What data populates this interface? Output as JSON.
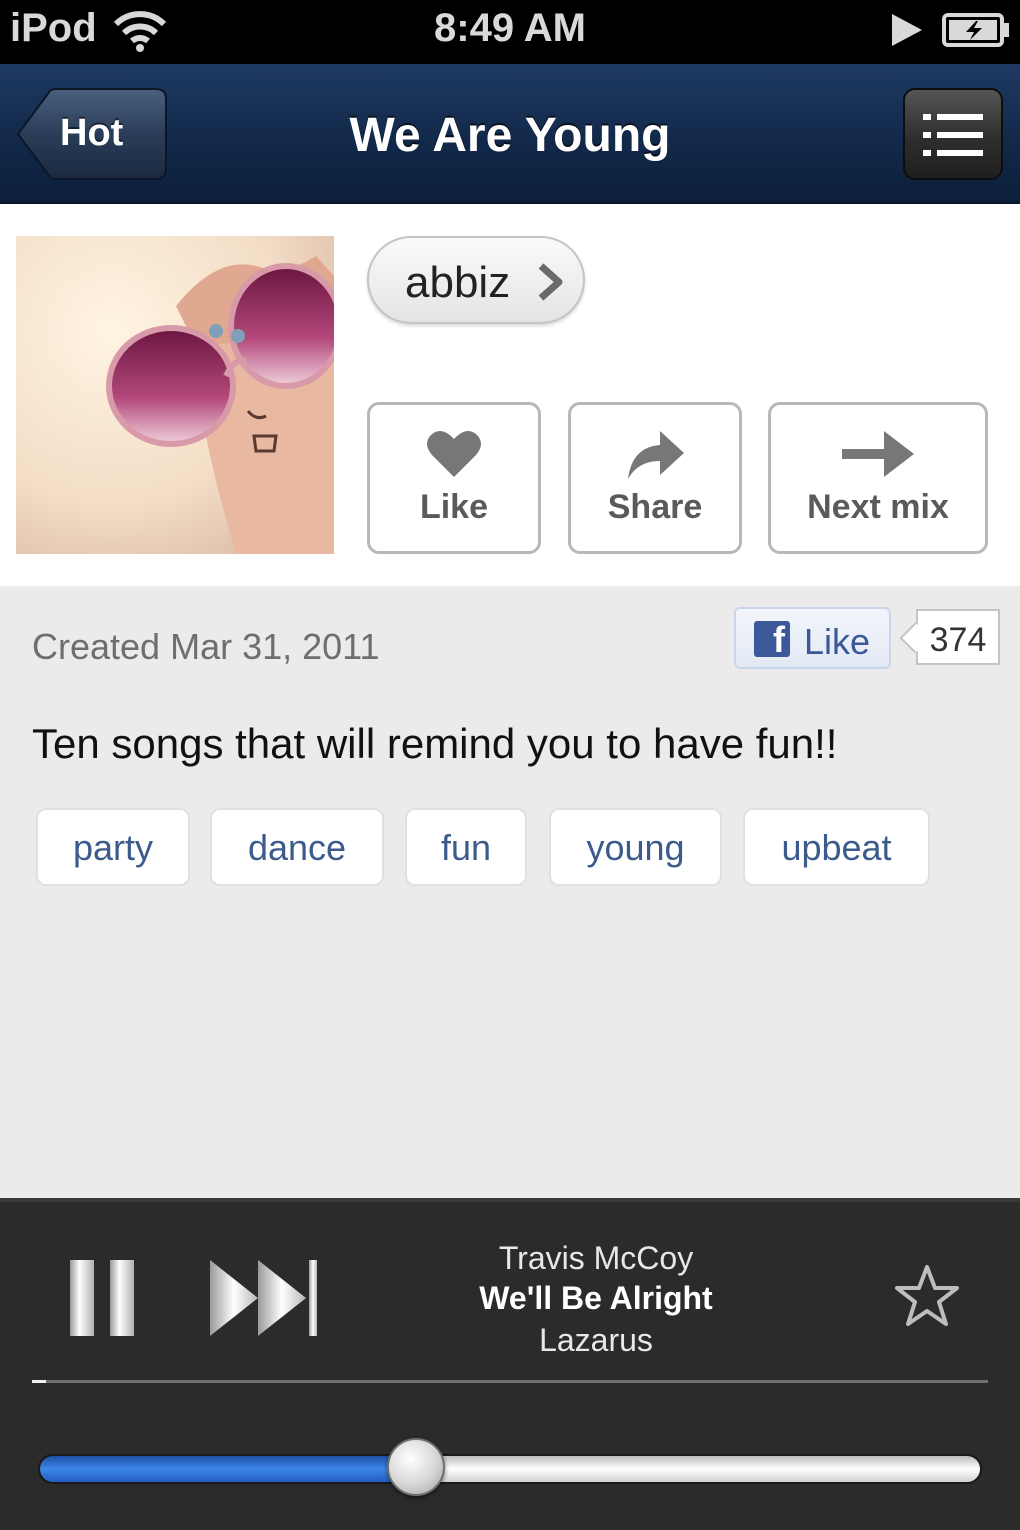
{
  "status_bar": {
    "carrier": "iPod",
    "time": "8:49 AM"
  },
  "nav": {
    "back_label": "Hot",
    "title": "We Are Young"
  },
  "mix": {
    "user": "abbiz",
    "actions": {
      "like": "Like",
      "share": "Share",
      "next": "Next mix"
    },
    "created": "Created Mar 31, 2011",
    "fb_like": {
      "label": "Like",
      "count": "374"
    },
    "description": "Ten songs that will remind you to have fun!!",
    "tags": [
      "party",
      "dance",
      "fun",
      "young",
      "upbeat"
    ]
  },
  "player": {
    "artist": "Travis McCoy",
    "title": "We'll Be Alright",
    "album": "Lazarus",
    "progress_fraction": 0.015,
    "volume_fraction": 0.4
  },
  "colors": {
    "nav_bar": "#12294a",
    "tag_text": "#3b5b8c",
    "facebook_blue": "#3b5998",
    "volume_fill": "#3d86e8",
    "player_bg": "#2b2b2b"
  },
  "icons": [
    "wifi-icon",
    "play-status-icon",
    "battery-icon",
    "menu-list-icon",
    "chevron-right-icon",
    "heart-icon",
    "share-arrow-icon",
    "next-arrow-icon",
    "facebook-icon",
    "pause-icon",
    "skip-forward-icon",
    "star-icon"
  ]
}
